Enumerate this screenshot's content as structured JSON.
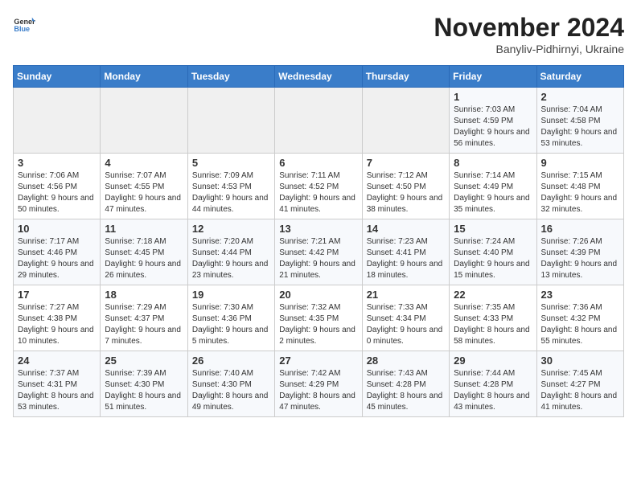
{
  "logo": {
    "line1": "General",
    "line2": "Blue"
  },
  "title": "November 2024",
  "subtitle": "Banyliv-Pidhirnyi, Ukraine",
  "weekdays": [
    "Sunday",
    "Monday",
    "Tuesday",
    "Wednesday",
    "Thursday",
    "Friday",
    "Saturday"
  ],
  "weeks": [
    [
      {
        "day": "",
        "info": ""
      },
      {
        "day": "",
        "info": ""
      },
      {
        "day": "",
        "info": ""
      },
      {
        "day": "",
        "info": ""
      },
      {
        "day": "",
        "info": ""
      },
      {
        "day": "1",
        "info": "Sunrise: 7:03 AM\nSunset: 4:59 PM\nDaylight: 9 hours and 56 minutes."
      },
      {
        "day": "2",
        "info": "Sunrise: 7:04 AM\nSunset: 4:58 PM\nDaylight: 9 hours and 53 minutes."
      }
    ],
    [
      {
        "day": "3",
        "info": "Sunrise: 7:06 AM\nSunset: 4:56 PM\nDaylight: 9 hours and 50 minutes."
      },
      {
        "day": "4",
        "info": "Sunrise: 7:07 AM\nSunset: 4:55 PM\nDaylight: 9 hours and 47 minutes."
      },
      {
        "day": "5",
        "info": "Sunrise: 7:09 AM\nSunset: 4:53 PM\nDaylight: 9 hours and 44 minutes."
      },
      {
        "day": "6",
        "info": "Sunrise: 7:11 AM\nSunset: 4:52 PM\nDaylight: 9 hours and 41 minutes."
      },
      {
        "day": "7",
        "info": "Sunrise: 7:12 AM\nSunset: 4:50 PM\nDaylight: 9 hours and 38 minutes."
      },
      {
        "day": "8",
        "info": "Sunrise: 7:14 AM\nSunset: 4:49 PM\nDaylight: 9 hours and 35 minutes."
      },
      {
        "day": "9",
        "info": "Sunrise: 7:15 AM\nSunset: 4:48 PM\nDaylight: 9 hours and 32 minutes."
      }
    ],
    [
      {
        "day": "10",
        "info": "Sunrise: 7:17 AM\nSunset: 4:46 PM\nDaylight: 9 hours and 29 minutes."
      },
      {
        "day": "11",
        "info": "Sunrise: 7:18 AM\nSunset: 4:45 PM\nDaylight: 9 hours and 26 minutes."
      },
      {
        "day": "12",
        "info": "Sunrise: 7:20 AM\nSunset: 4:44 PM\nDaylight: 9 hours and 23 minutes."
      },
      {
        "day": "13",
        "info": "Sunrise: 7:21 AM\nSunset: 4:42 PM\nDaylight: 9 hours and 21 minutes."
      },
      {
        "day": "14",
        "info": "Sunrise: 7:23 AM\nSunset: 4:41 PM\nDaylight: 9 hours and 18 minutes."
      },
      {
        "day": "15",
        "info": "Sunrise: 7:24 AM\nSunset: 4:40 PM\nDaylight: 9 hours and 15 minutes."
      },
      {
        "day": "16",
        "info": "Sunrise: 7:26 AM\nSunset: 4:39 PM\nDaylight: 9 hours and 13 minutes."
      }
    ],
    [
      {
        "day": "17",
        "info": "Sunrise: 7:27 AM\nSunset: 4:38 PM\nDaylight: 9 hours and 10 minutes."
      },
      {
        "day": "18",
        "info": "Sunrise: 7:29 AM\nSunset: 4:37 PM\nDaylight: 9 hours and 7 minutes."
      },
      {
        "day": "19",
        "info": "Sunrise: 7:30 AM\nSunset: 4:36 PM\nDaylight: 9 hours and 5 minutes."
      },
      {
        "day": "20",
        "info": "Sunrise: 7:32 AM\nSunset: 4:35 PM\nDaylight: 9 hours and 2 minutes."
      },
      {
        "day": "21",
        "info": "Sunrise: 7:33 AM\nSunset: 4:34 PM\nDaylight: 9 hours and 0 minutes."
      },
      {
        "day": "22",
        "info": "Sunrise: 7:35 AM\nSunset: 4:33 PM\nDaylight: 8 hours and 58 minutes."
      },
      {
        "day": "23",
        "info": "Sunrise: 7:36 AM\nSunset: 4:32 PM\nDaylight: 8 hours and 55 minutes."
      }
    ],
    [
      {
        "day": "24",
        "info": "Sunrise: 7:37 AM\nSunset: 4:31 PM\nDaylight: 8 hours and 53 minutes."
      },
      {
        "day": "25",
        "info": "Sunrise: 7:39 AM\nSunset: 4:30 PM\nDaylight: 8 hours and 51 minutes."
      },
      {
        "day": "26",
        "info": "Sunrise: 7:40 AM\nSunset: 4:30 PM\nDaylight: 8 hours and 49 minutes."
      },
      {
        "day": "27",
        "info": "Sunrise: 7:42 AM\nSunset: 4:29 PM\nDaylight: 8 hours and 47 minutes."
      },
      {
        "day": "28",
        "info": "Sunrise: 7:43 AM\nSunset: 4:28 PM\nDaylight: 8 hours and 45 minutes."
      },
      {
        "day": "29",
        "info": "Sunrise: 7:44 AM\nSunset: 4:28 PM\nDaylight: 8 hours and 43 minutes."
      },
      {
        "day": "30",
        "info": "Sunrise: 7:45 AM\nSunset: 4:27 PM\nDaylight: 8 hours and 41 minutes."
      }
    ]
  ]
}
